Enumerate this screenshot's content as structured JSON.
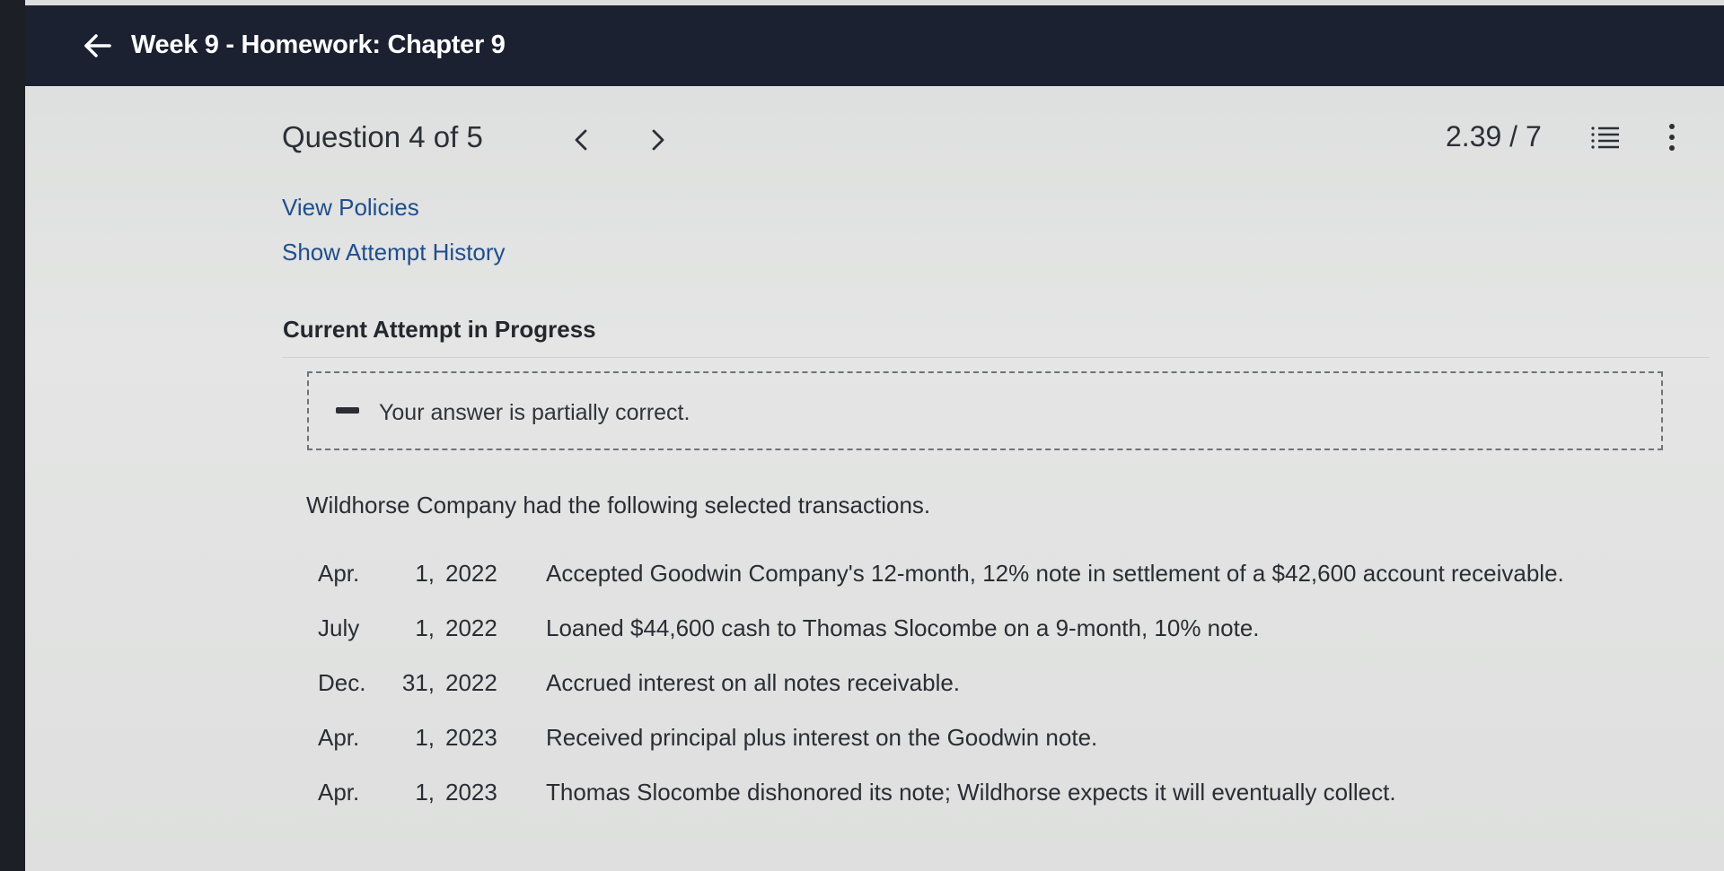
{
  "header": {
    "title": "Week 9 - Homework: Chapter 9"
  },
  "question": {
    "label": "Question 4 of 5",
    "score": "2.39 / 7"
  },
  "links": {
    "view_policies": "View Policies",
    "show_attempt_history": "Show Attempt History"
  },
  "attempt": {
    "heading": "Current Attempt in Progress",
    "feedback": "Your answer is partially correct."
  },
  "problem": {
    "intro": "Wildhorse Company had the following selected transactions.",
    "transactions": [
      {
        "month": "Apr.",
        "day": "1,",
        "year": "2022",
        "description": "Accepted Goodwin Company's 12-month, 12% note in settlement of a $42,600 account receivable."
      },
      {
        "month": "July",
        "day": "1,",
        "year": "2022",
        "description": "Loaned $44,600 cash to Thomas Slocombe on a 9-month, 10% note."
      },
      {
        "month": "Dec.",
        "day": "31,",
        "year": "2022",
        "description": "Accrued interest on all notes receivable."
      },
      {
        "month": "Apr.",
        "day": "1,",
        "year": "2023",
        "description": "Received principal plus interest on the Goodwin note."
      },
      {
        "month": "Apr.",
        "day": "1,",
        "year": "2023",
        "description": "Thomas Slocombe dishonored its note; Wildhorse expects it will eventually collect."
      }
    ]
  },
  "icons": {
    "back": "arrow-left-icon",
    "prev": "chevron-left-icon",
    "next": "chevron-right-icon",
    "list": "list-icon",
    "more": "more-vertical-icon",
    "feedback": "minus-icon"
  },
  "colors": {
    "topbar": "#1b2130",
    "link": "#1f4e8c",
    "background": "#e0e1e0"
  }
}
